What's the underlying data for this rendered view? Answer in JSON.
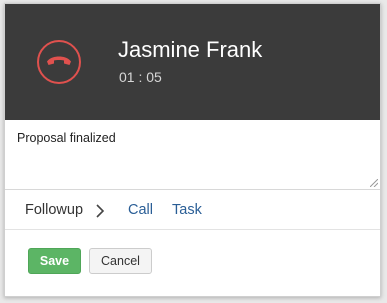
{
  "call": {
    "caller_name": "Jasmine Frank",
    "duration": "01 : 05",
    "end_call_icon": "phone-hangup-icon",
    "end_call_color": "#e0514e"
  },
  "notes": {
    "value": "Proposal finalized"
  },
  "followup": {
    "label": "Followup",
    "options": [
      "Call",
      "Task"
    ]
  },
  "actions": {
    "save_label": "Save",
    "cancel_label": "Cancel",
    "save_color": "#5cb565"
  },
  "colors": {
    "header_bg": "#3b3b3b",
    "link": "#2a5e96"
  }
}
